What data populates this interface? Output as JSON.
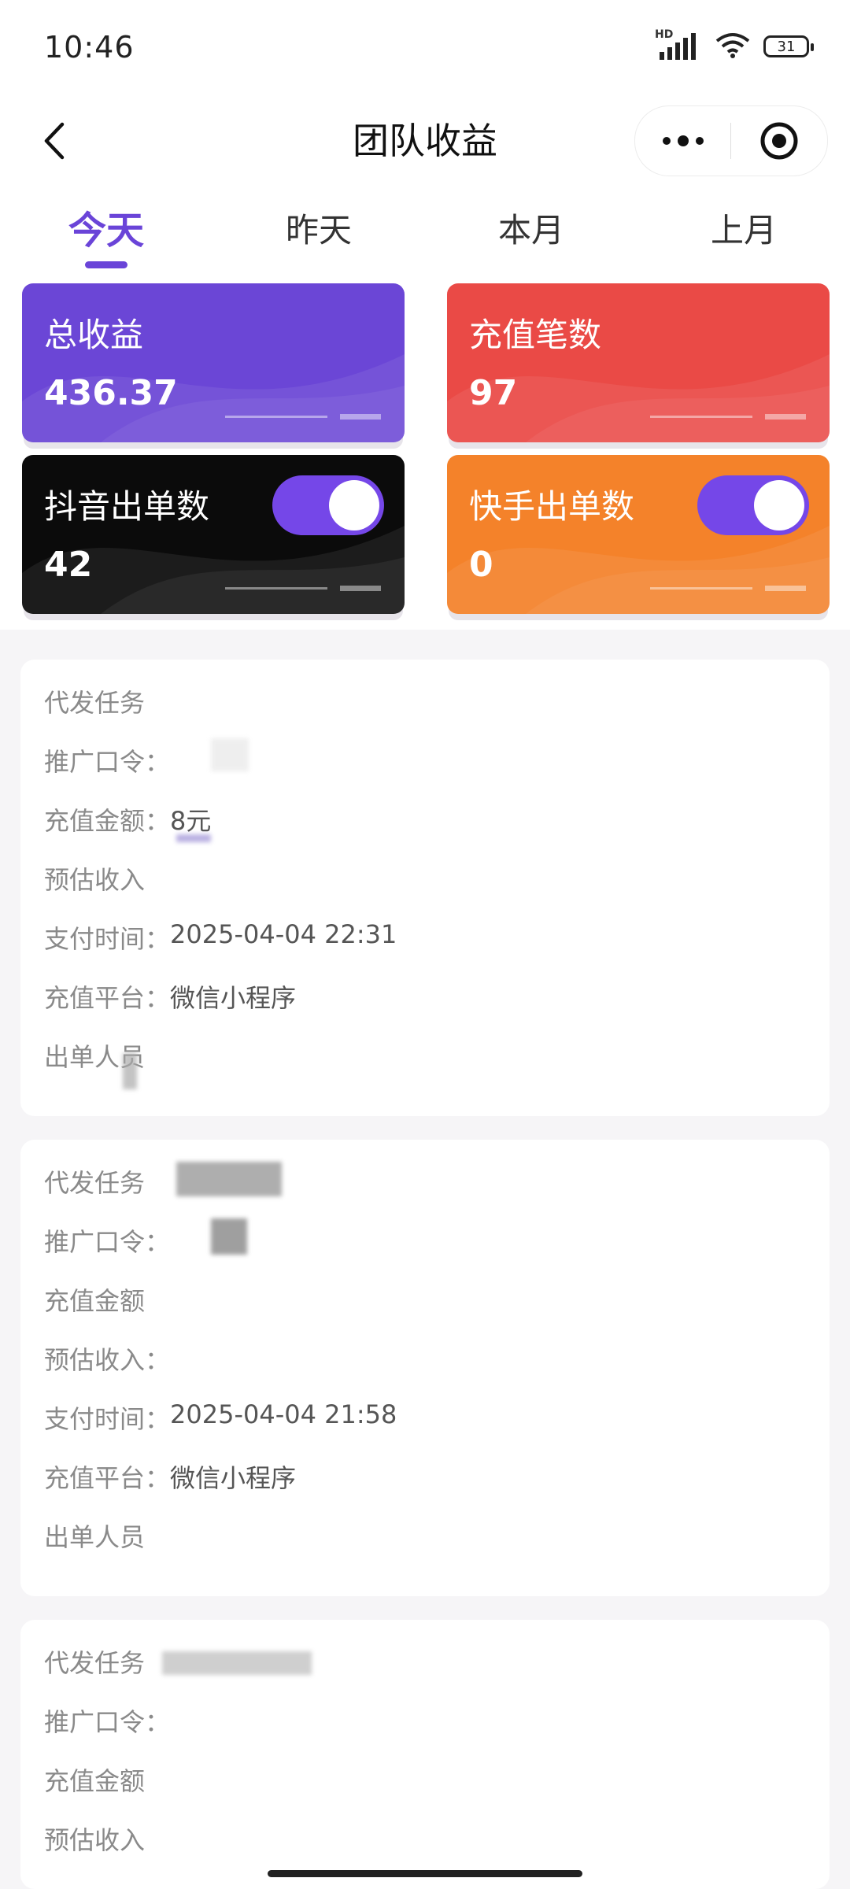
{
  "status_bar": {
    "time": "10:46",
    "network": "HD",
    "battery": "31"
  },
  "nav": {
    "title": "团队收益"
  },
  "tabs": [
    {
      "label": "今天",
      "active": true
    },
    {
      "label": "昨天",
      "active": false
    },
    {
      "label": "本月",
      "active": false
    },
    {
      "label": "上月",
      "active": false
    }
  ],
  "stats": [
    {
      "label": "总收益",
      "value": "436.37",
      "color": "#6b46d6"
    },
    {
      "label": "充值笔数",
      "value": "97",
      "color": "#ea4a46"
    },
    {
      "label": "抖音出单数",
      "value": "42",
      "color": "#0b0b0b",
      "toggle_on": true
    },
    {
      "label": "快手出单数",
      "value": "0",
      "color": "#f4822a",
      "toggle_on": true
    }
  ],
  "records": [
    {
      "task_label": "代发任务",
      "code_label": "推广口令：",
      "amount_label": "充值金额：",
      "amount_value": "8元",
      "income_label": "预估收入",
      "time_label": "支付时间：",
      "time_value": "2025-04-04 22:31",
      "platform_label": "充值平台：",
      "platform_value": "微信小程序",
      "person_label": "出单人员"
    },
    {
      "task_label": "代发任务",
      "code_label": "推广口令：",
      "amount_label": "充值金额",
      "income_label": "预估收入：",
      "time_label": "支付时间：",
      "time_value": "2025-04-04 21:58",
      "platform_label": "充值平台：",
      "platform_value": "微信小程序",
      "person_label": "出单人员"
    },
    {
      "task_label": "代发任务",
      "code_label": "推广口令：",
      "amount_label": "充值金额",
      "income_label": "预估收入"
    }
  ]
}
